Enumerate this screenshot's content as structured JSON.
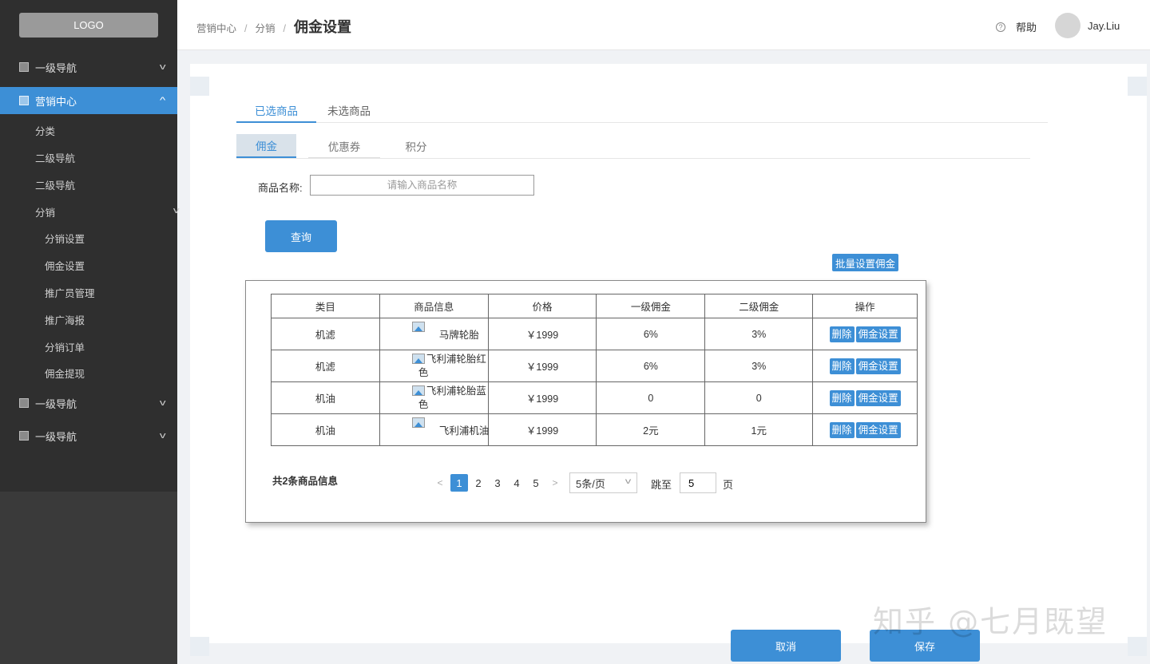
{
  "logo": "LOGO",
  "sidebar": {
    "nav1": "一级导航",
    "marketing": "营销中心",
    "sub_classify": "分类",
    "sub_nav2_a": "二级导航",
    "sub_nav2_b": "二级导航",
    "sub_distribution": "分销",
    "dist_items": [
      "分销设置",
      "佣金设置",
      "推广员管理",
      "推广海报",
      "分销订单",
      "佣金提现"
    ],
    "nav1_b": "一级导航",
    "nav1_c": "一级导航"
  },
  "header": {
    "breadcrumb": [
      "营销中心",
      "分销",
      "佣金设置"
    ],
    "sep": "/",
    "help": "帮助",
    "username": "Jay.Liu"
  },
  "tabs_primary": [
    "已选商品",
    "未选商品"
  ],
  "tabs_secondary": [
    "佣金",
    "优惠券",
    "积分"
  ],
  "search": {
    "label": "商品名称:",
    "placeholder": "请输入商品名称",
    "button": "查询"
  },
  "batch_button": "批量设置佣金",
  "table": {
    "headers": [
      "类目",
      "商品信息",
      "价格",
      "一级佣金",
      "二级佣金",
      "操作"
    ],
    "rows": [
      {
        "category": "机滤",
        "product": "马牌轮胎",
        "price": "￥1999",
        "level1": "6%",
        "level2": "3%"
      },
      {
        "category": "机滤",
        "product": "飞利浦轮胎红色",
        "price": "￥1999",
        "level1": "6%",
        "level2": "3%"
      },
      {
        "category": "机油",
        "product": "飞利浦轮胎蓝色",
        "price": "￥1999",
        "level1": "0",
        "level2": "0"
      },
      {
        "category": "机油",
        "product": "飞利浦机油",
        "price": "￥1999",
        "level1": "2元",
        "level2": "1元"
      }
    ],
    "action_delete": "删除",
    "action_setting": "佣金设置"
  },
  "pagination": {
    "total": "共2条商品信息",
    "pages": [
      "1",
      "2",
      "3",
      "4",
      "5"
    ],
    "current_page": "1",
    "page_size": "5条/页",
    "jump_label": "跳至",
    "jump_value": "5",
    "page_unit": "页"
  },
  "footer": {
    "cancel": "取消",
    "save": "保存"
  },
  "watermark": "知乎 @七月既望",
  "colors": {
    "accent": "#3d8fd6",
    "sidebar_bg": "#2f2f2f"
  }
}
